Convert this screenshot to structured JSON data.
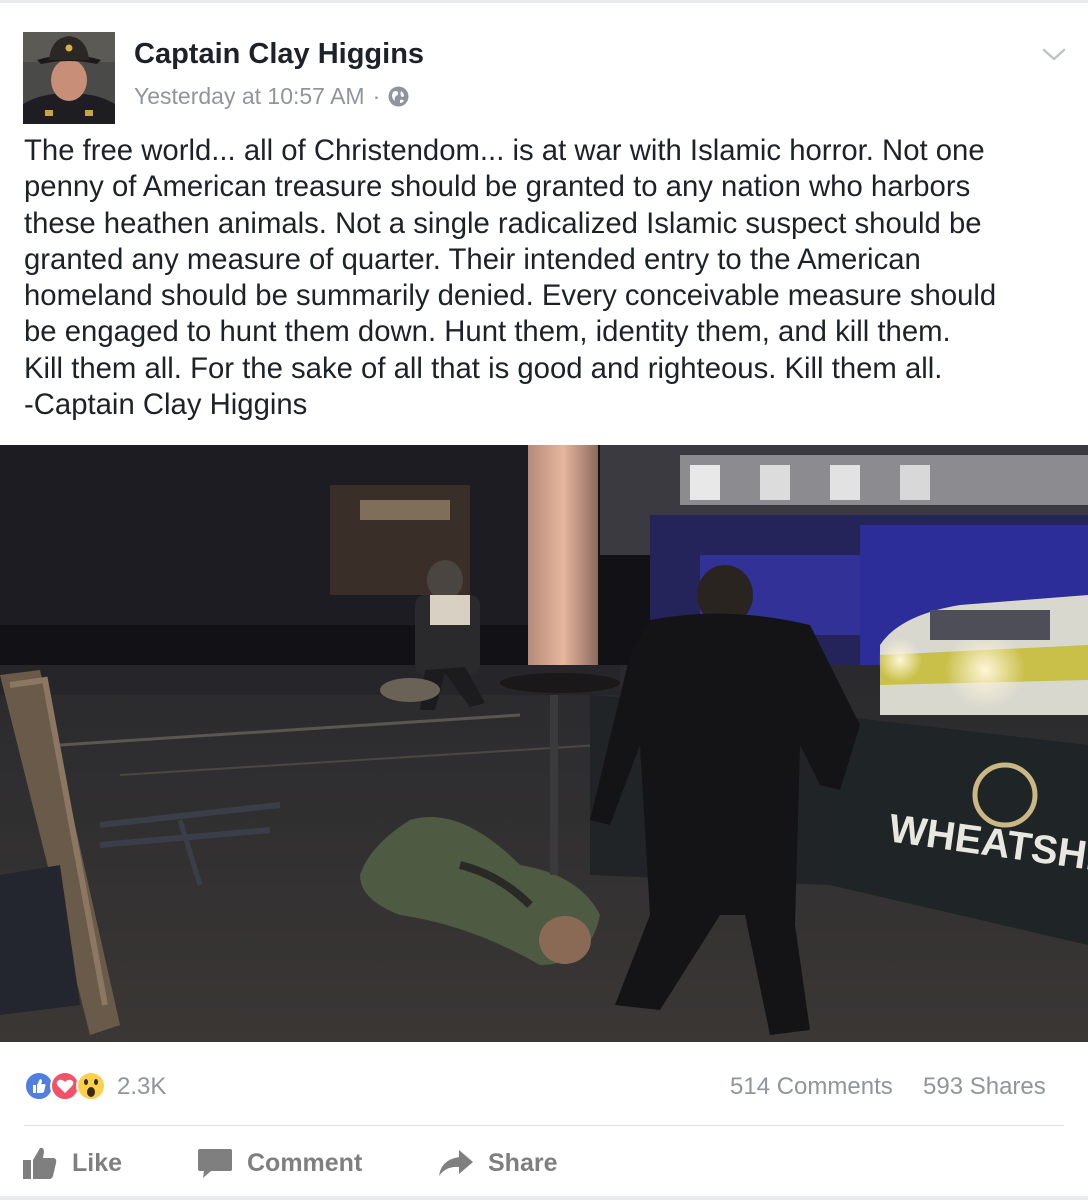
{
  "post": {
    "author": "Captain Clay Higgins",
    "timestamp": "Yesterday at 10:57 AM",
    "separator": "·",
    "privacy_icon": "globe-icon",
    "menu_icon": "chevron-down-icon",
    "text": "The free world... all of Christendom... is at war with Islamic horror. Not one\npenny of American treasure should be granted to any nation who harbors\nthese heathen animals. Not a single radicalized Islamic suspect should be\ngranted any measure of quarter. Their intended entry to the American\nhomeland should be summarily denied. Every conceivable measure should\nbe engaged to hunt them down. Hunt them, identity them, and kill them.\nKill them all. For the sake of all that is good and righteous. Kill them all.\n-Captain Clay Higgins",
    "photo": {
      "sign_text": "WHEATSHEA"
    }
  },
  "engagement": {
    "reaction_icons": [
      "like-icon",
      "love-icon",
      "wow-icon"
    ],
    "reactions_count": "2.3K",
    "comments": "514 Comments",
    "shares": "593 Shares"
  },
  "actions": {
    "like": "Like",
    "comment": "Comment",
    "share": "Share"
  },
  "colors": {
    "text": "#1d2129",
    "secondary": "#90949c",
    "action": "#7f7f7f",
    "like_blue": "#3b5998",
    "love_red": "#f25268",
    "wow_yellow": "#fcd04c"
  }
}
